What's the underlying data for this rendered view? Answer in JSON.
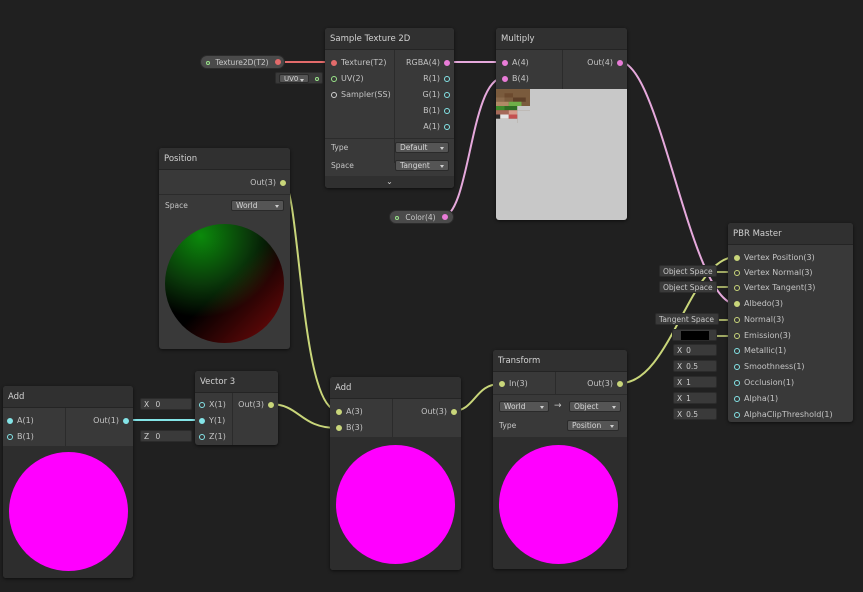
{
  "nodes": {
    "sample_texture": {
      "title": "Sample Texture 2D",
      "inputs": [
        "Texture(T2)",
        "UV(2)",
        "Sampler(SS)"
      ],
      "outputs": [
        "RGBA(4)",
        "R(1)",
        "G(1)",
        "B(1)",
        "A(1)"
      ],
      "type_label": "Type",
      "type_value": "Default",
      "space_label": "Space",
      "space_value": "Tangent"
    },
    "multiply": {
      "title": "Multiply",
      "inputs": [
        "A(4)",
        "B(4)"
      ],
      "output": "Out(4)"
    },
    "position": {
      "title": "Position",
      "output": "Out(3)",
      "space_label": "Space",
      "space_value": "World"
    },
    "pbr": {
      "title": "PBR Master",
      "inputs": [
        "Vertex Position(3)",
        "Vertex Normal(3)",
        "Vertex Tangent(3)",
        "Albedo(3)",
        "Normal(3)",
        "Emission(3)",
        "Metallic(1)",
        "Smoothness(1)",
        "Occlusion(1)",
        "Alpha(1)",
        "AlphaClipThreshold(1)"
      ],
      "left_fields": {
        "vertex_normal": "Object Space",
        "vertex_tangent": "Object Space",
        "normal": "Tangent Space",
        "metallic": "0",
        "smoothness": "0.5",
        "occlusion": "1",
        "alpha": "1",
        "alpha_clip": "0.5"
      },
      "x_label": "X"
    },
    "add_left": {
      "title": "Add",
      "inputs": [
        "A(1)",
        "B(1)"
      ],
      "output": "Out(1)"
    },
    "vector3": {
      "title": "Vector 3",
      "inputs": [
        "X(1)",
        "Y(1)",
        "Z(1)"
      ],
      "output": "Out(3)",
      "x_label": "X",
      "x_value": "0",
      "z_label": "Z",
      "z_value": "0"
    },
    "add_mid": {
      "title": "Add",
      "inputs": [
        "A(3)",
        "B(3)"
      ],
      "output": "Out(3)"
    },
    "transform": {
      "title": "Transform",
      "input": "In(3)",
      "output": "Out(3)",
      "from_space": "World",
      "to_space": "Object",
      "type_label": "Type",
      "type_value": "Position"
    },
    "texture_property": {
      "label": "Texture2D(T2)"
    },
    "uv_field": {
      "label": "UV0"
    },
    "color_property": {
      "label": "Color(4)"
    }
  },
  "colors": {
    "background": "#202020",
    "node": "#393939",
    "wire_yellow": "#c9d67a",
    "wire_pink": "#e6a9dc",
    "wire_red": "#e36b6b",
    "wire_teal": "#84e4e7",
    "magenta_preview": "#ff00ff"
  }
}
